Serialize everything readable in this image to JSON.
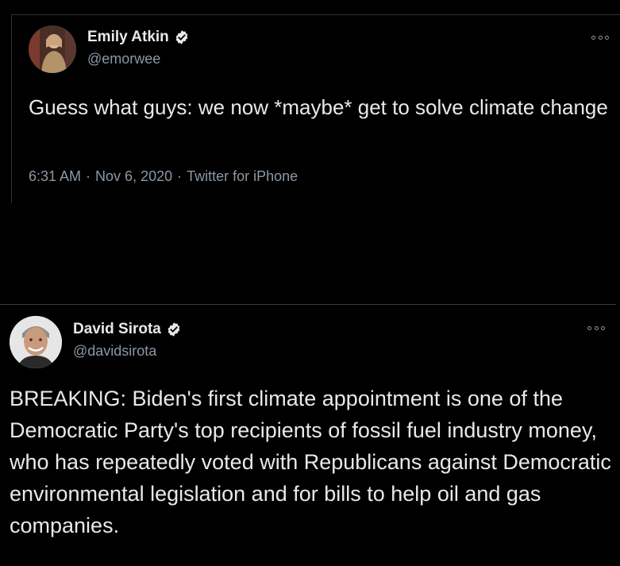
{
  "tweets": [
    {
      "author_name": "Emily Atkin",
      "handle": "@emorwee",
      "verified": true,
      "text": "Guess what guys: we now *maybe* get to solve climate change",
      "time": "6:31 AM",
      "date": "Nov 6, 2020",
      "source": "Twitter for iPhone",
      "separator": "·"
    },
    {
      "author_name": "David Sirota",
      "handle": "@davidsirota",
      "verified": true,
      "text": "BREAKING: Biden's first climate appointment is one of the Democratic Party's top recipients of fossil fuel industry money, who has repeatedly voted with Republicans against Democratic environmental legislation and for bills to help oil and gas companies."
    }
  ],
  "icons": {
    "verified": "verified-badge-icon",
    "more": "more-options-icon"
  },
  "colors": {
    "background": "#000000",
    "text": "#e7e9ea",
    "secondary_text": "#8b98a5",
    "divider": "#2f3336"
  }
}
